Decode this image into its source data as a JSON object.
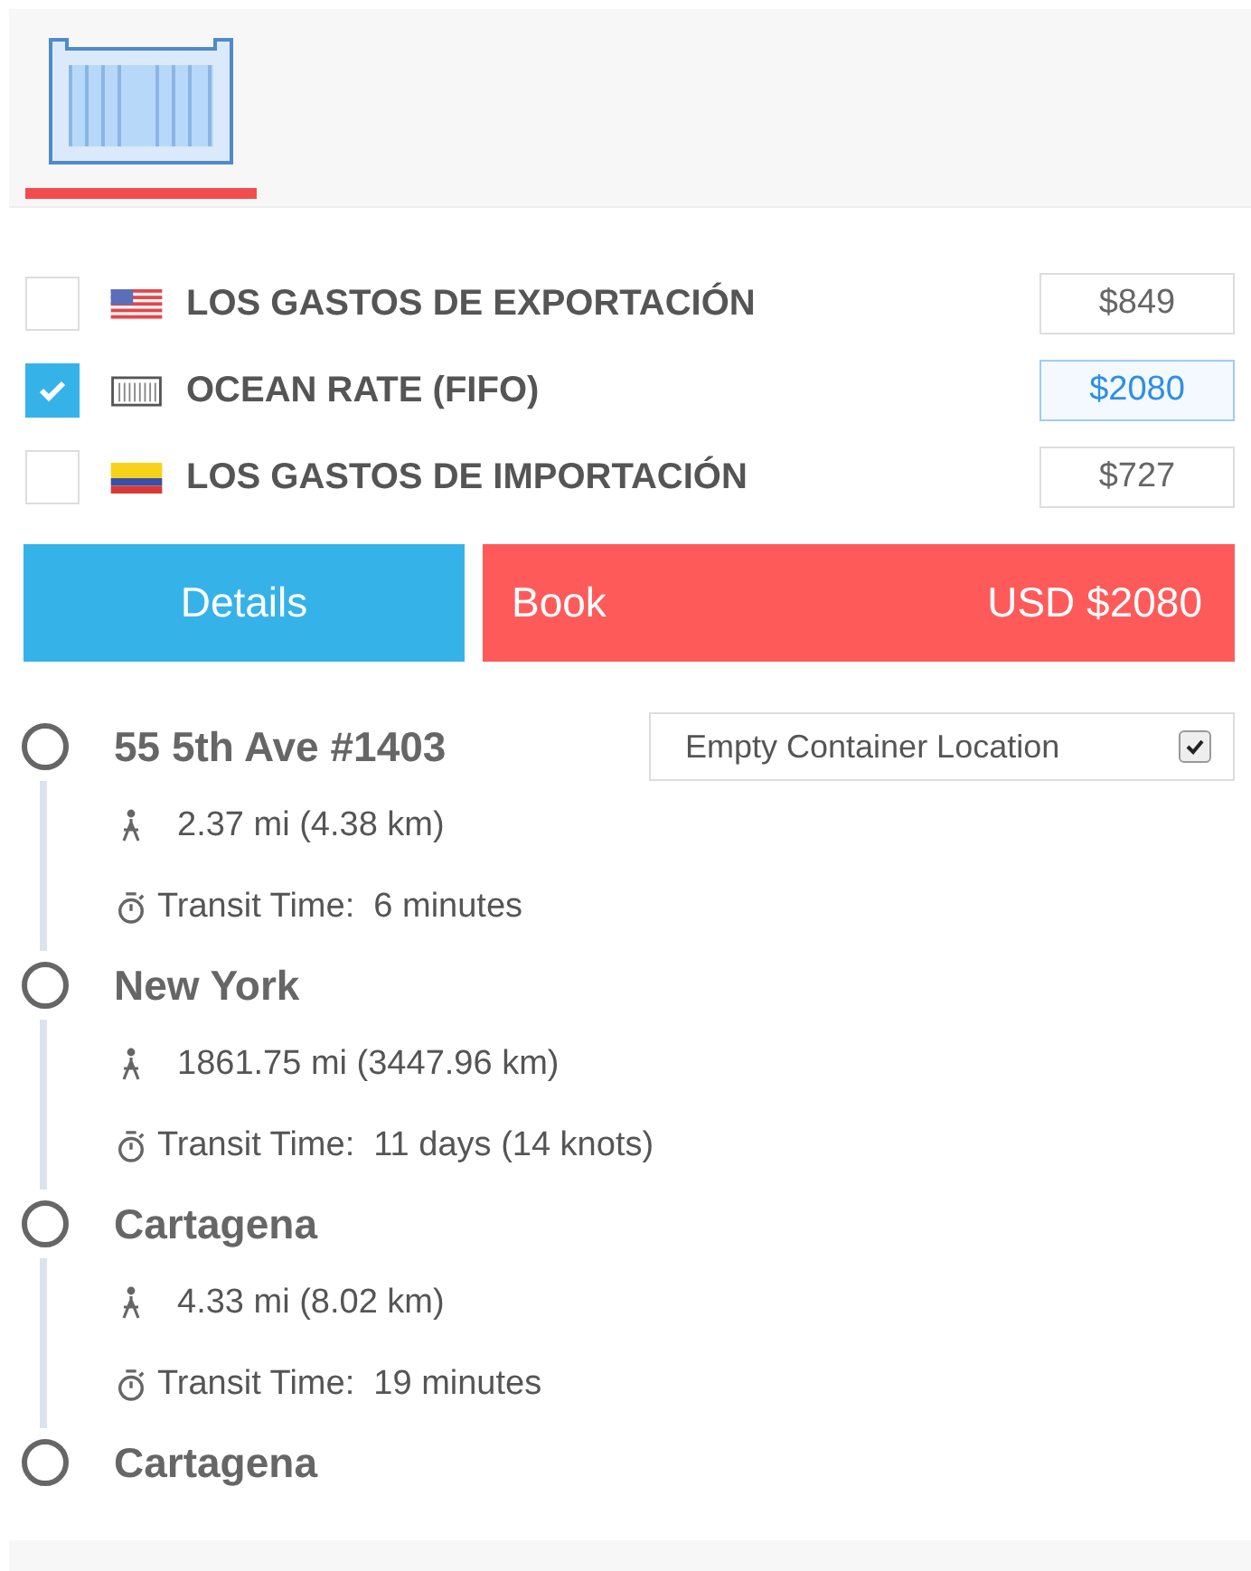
{
  "tabs": [
    {
      "kind": "container",
      "selected": true
    }
  ],
  "charges": [
    {
      "checked": false,
      "kind": "us-flag",
      "label": "LOS GASTOS DE EXPORTACIÓN",
      "price": "$849",
      "focused": false
    },
    {
      "checked": true,
      "kind": "container",
      "label": "OCEAN RATE (FIFO)",
      "price": "$2080",
      "focused": true
    },
    {
      "checked": false,
      "kind": "co-flag",
      "label": "LOS GASTOS DE IMPORTACIÓN",
      "price": "$727",
      "focused": false
    }
  ],
  "actions": {
    "details": "Details",
    "book": "Book",
    "total": "USD $2080"
  },
  "stops": [
    {
      "name": "55 5th Ave #1403",
      "option": {
        "label": "Empty Container Location",
        "checked": true
      },
      "leg": {
        "distance": "2.37 mi (4.38 km)",
        "transit": "Transit Time:  6 minutes"
      }
    },
    {
      "name": "New York",
      "leg": {
        "distance": "1861.75 mi (3447.96 km)",
        "transit": "Transit Time:  11 days (14 knots)"
      }
    },
    {
      "name": "Cartagena",
      "leg": {
        "distance": "4.33 mi (8.02 km)",
        "transit": "Transit Time:  19 minutes"
      }
    },
    {
      "name": "Cartagena"
    }
  ]
}
